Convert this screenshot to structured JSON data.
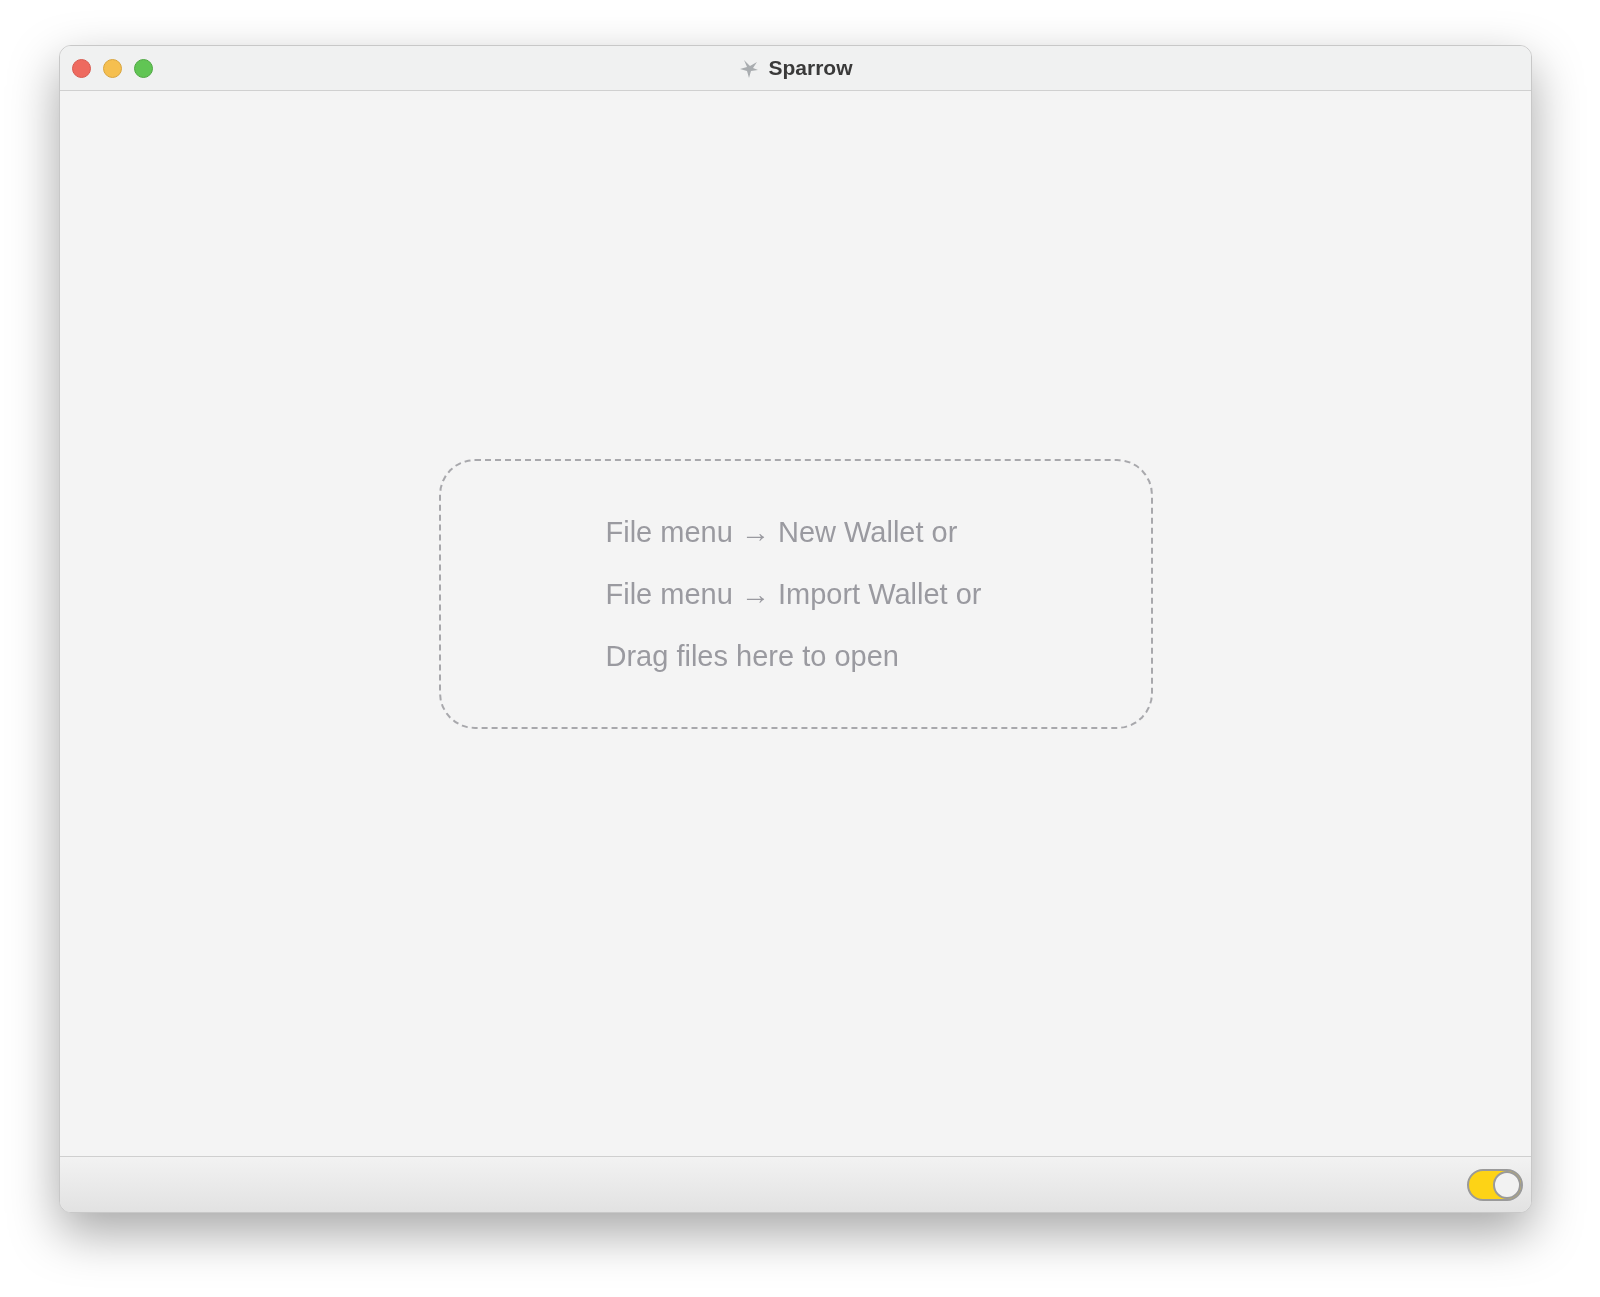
{
  "window": {
    "title": "Sparrow"
  },
  "drop_area": {
    "lines": [
      "File menu → New Wallet or",
      "File menu → Import Wallet or",
      "Drag files here to open"
    ]
  },
  "status_bar": {
    "toggle": {
      "on": true
    }
  }
}
